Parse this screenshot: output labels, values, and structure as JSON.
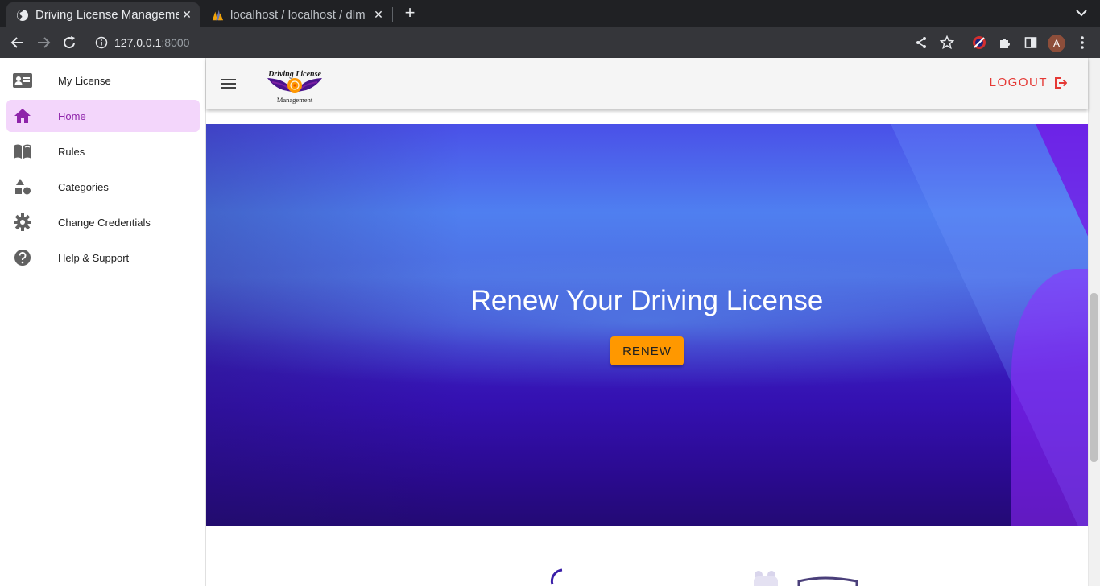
{
  "browser": {
    "tabs": [
      {
        "title": "Driving License Management",
        "active": true
      },
      {
        "title": "localhost / localhost / dlm",
        "active": false
      }
    ],
    "url_host": "127.0.0.1",
    "url_port": ":8000",
    "profile_initial": "A"
  },
  "sidebar": {
    "items": [
      {
        "label": "My License",
        "icon": "id-card-icon",
        "active": false
      },
      {
        "label": "Home",
        "icon": "home-icon",
        "active": true
      },
      {
        "label": "Rules",
        "icon": "book-icon",
        "active": false
      },
      {
        "label": "Categories",
        "icon": "shapes-icon",
        "active": false
      },
      {
        "label": "Change Credentials",
        "icon": "gear-icon",
        "active": false
      },
      {
        "label": "Help & Support",
        "icon": "help-icon",
        "active": false
      }
    ]
  },
  "header": {
    "logo_top": "Driving License",
    "logo_bottom": "Management",
    "logout_label": "LOGOUT"
  },
  "hero": {
    "title": "Renew Your Driving License",
    "button_label": "RENEW"
  },
  "colors": {
    "accent": "#8e24aa",
    "active_nav_bg": "#f3d6fb",
    "logout": "#e53935",
    "renew_button": "#ff9800"
  }
}
